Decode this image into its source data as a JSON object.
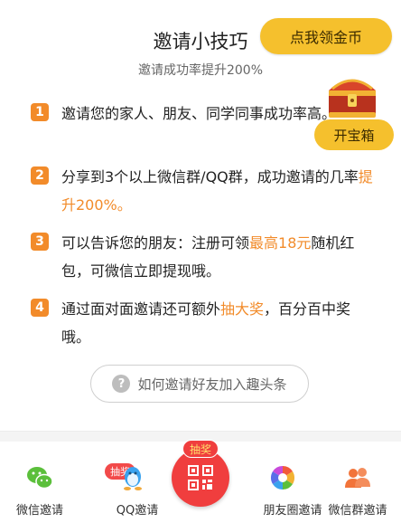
{
  "header": {
    "title": "邀请小技巧",
    "subtitle": "邀请成功率提升200%",
    "coin_button": "点我领金币",
    "open_chest_button": "开宝箱"
  },
  "tips": [
    {
      "num": "1",
      "parts": [
        {
          "text": "邀请您的家人、朋友、同学同事成功率高。",
          "hl": false
        }
      ]
    },
    {
      "num": "2",
      "parts": [
        {
          "text": "分享到3个以上微信群/QQ群，成功邀请的几率",
          "hl": false
        },
        {
          "text": "提升200%。",
          "hl": true
        }
      ]
    },
    {
      "num": "3",
      "parts": [
        {
          "text": "可以告诉您的朋友：注册可领",
          "hl": false
        },
        {
          "text": "最高18元",
          "hl": true
        },
        {
          "text": "随机红包，可微信立即提现哦。",
          "hl": false
        }
      ]
    },
    {
      "num": "4",
      "parts": [
        {
          "text": "通过面对面邀请还可额外",
          "hl": false
        },
        {
          "text": "抽大奖",
          "hl": true
        },
        {
          "text": "，百分百中奖哦。",
          "hl": false
        }
      ]
    }
  ],
  "help": {
    "icon_glyph": "?",
    "label": "如何邀请好友加入趣头条"
  },
  "bottom_bar": {
    "wechat_label": "微信邀请",
    "qq_label": "QQ邀请",
    "qq_badge": "抽奖",
    "center_badge": "抽奖",
    "moments_label": "朋友圈邀请",
    "group_label": "微信群邀请"
  },
  "colors": {
    "accent_orange": "#f28b2a",
    "gold": "#f5c02d",
    "red": "#f03e3e",
    "wechat_green": "#5bbf3b",
    "qq_blue": "#3aa2ee",
    "group_orange": "#f2743a"
  },
  "icons": {
    "wechat": "wechat-icon",
    "qq": "qq-penguin-icon",
    "qr": "qr-code-icon",
    "moments": "camera-aperture-icon",
    "group": "people-group-icon",
    "chest": "treasure-chest-icon",
    "help": "question-circle-icon"
  }
}
